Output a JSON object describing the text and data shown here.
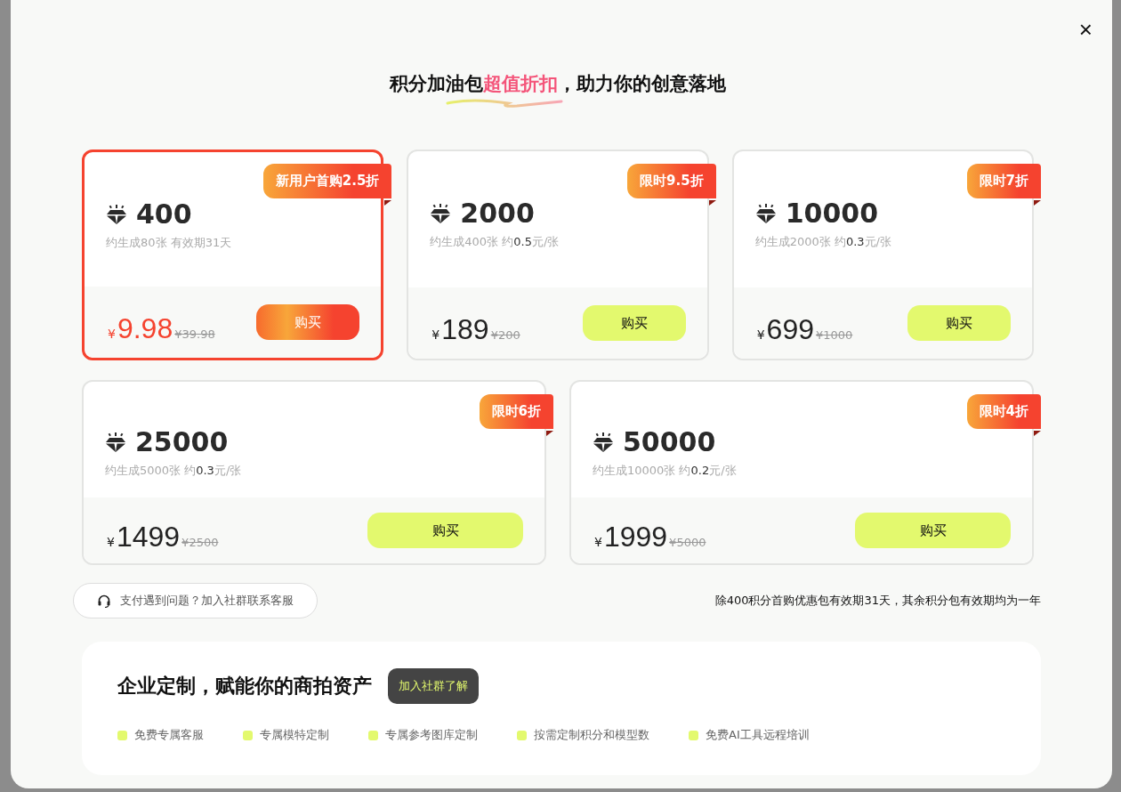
{
  "dialog": {
    "title": "积分加油包**超值折扣**，助力你的创意落地",
    "close": "×"
  },
  "packs": [
    {
      "points": "400",
      "desc": "约生成80张 有效期31天",
      "badge": "新用户首购2.5折",
      "currency": "¥",
      "price": "9.98",
      "original": "¥39.98",
      "buy": "购买",
      "selected": true
    },
    {
      "points": "2000",
      "desc": "约生成400张 约**0.5**元/张",
      "badge": "限时9.5折",
      "currency": "¥",
      "price": "189",
      "original": "¥200",
      "buy": "购买",
      "selected": false
    },
    {
      "points": "10000",
      "desc": "约生成2000张 约**0.3**元/张",
      "badge": "限时7折",
      "currency": "¥",
      "price": "699",
      "original": "¥1000",
      "buy": "购买",
      "selected": false
    },
    {
      "points": "25000",
      "desc": "约生成5000张 约**0.3**元/张",
      "badge": "限时6折",
      "currency": "¥",
      "price": "1499",
      "original": "¥2500",
      "buy": "购买",
      "selected": false
    },
    {
      "points": "50000",
      "desc": "约生成10000张 约**0.2**元/张",
      "badge": "限时4折",
      "currency": "¥",
      "price": "1999",
      "original": "¥5000",
      "buy": "购买",
      "selected": false
    }
  ],
  "support": {
    "label": "支付遇到问题？加入社群联系客服"
  },
  "note": "除400积分首购优惠包有效期31天，其余积分包有效期均为一年",
  "enterprise": {
    "title": "企业定制，赋能你的商拍资产",
    "button": "加入社群了解",
    "features": [
      {
        "label": "免费专属客服",
        "checked": true
      },
      {
        "label": "专属模特定制",
        "checked": true
      },
      {
        "label": "专属参考图库定制",
        "checked": true
      },
      {
        "label": "按需定制积分和模型数",
        "checked": true
      },
      {
        "label": "免费AI工具远程培训",
        "checked": true
      }
    ]
  }
}
